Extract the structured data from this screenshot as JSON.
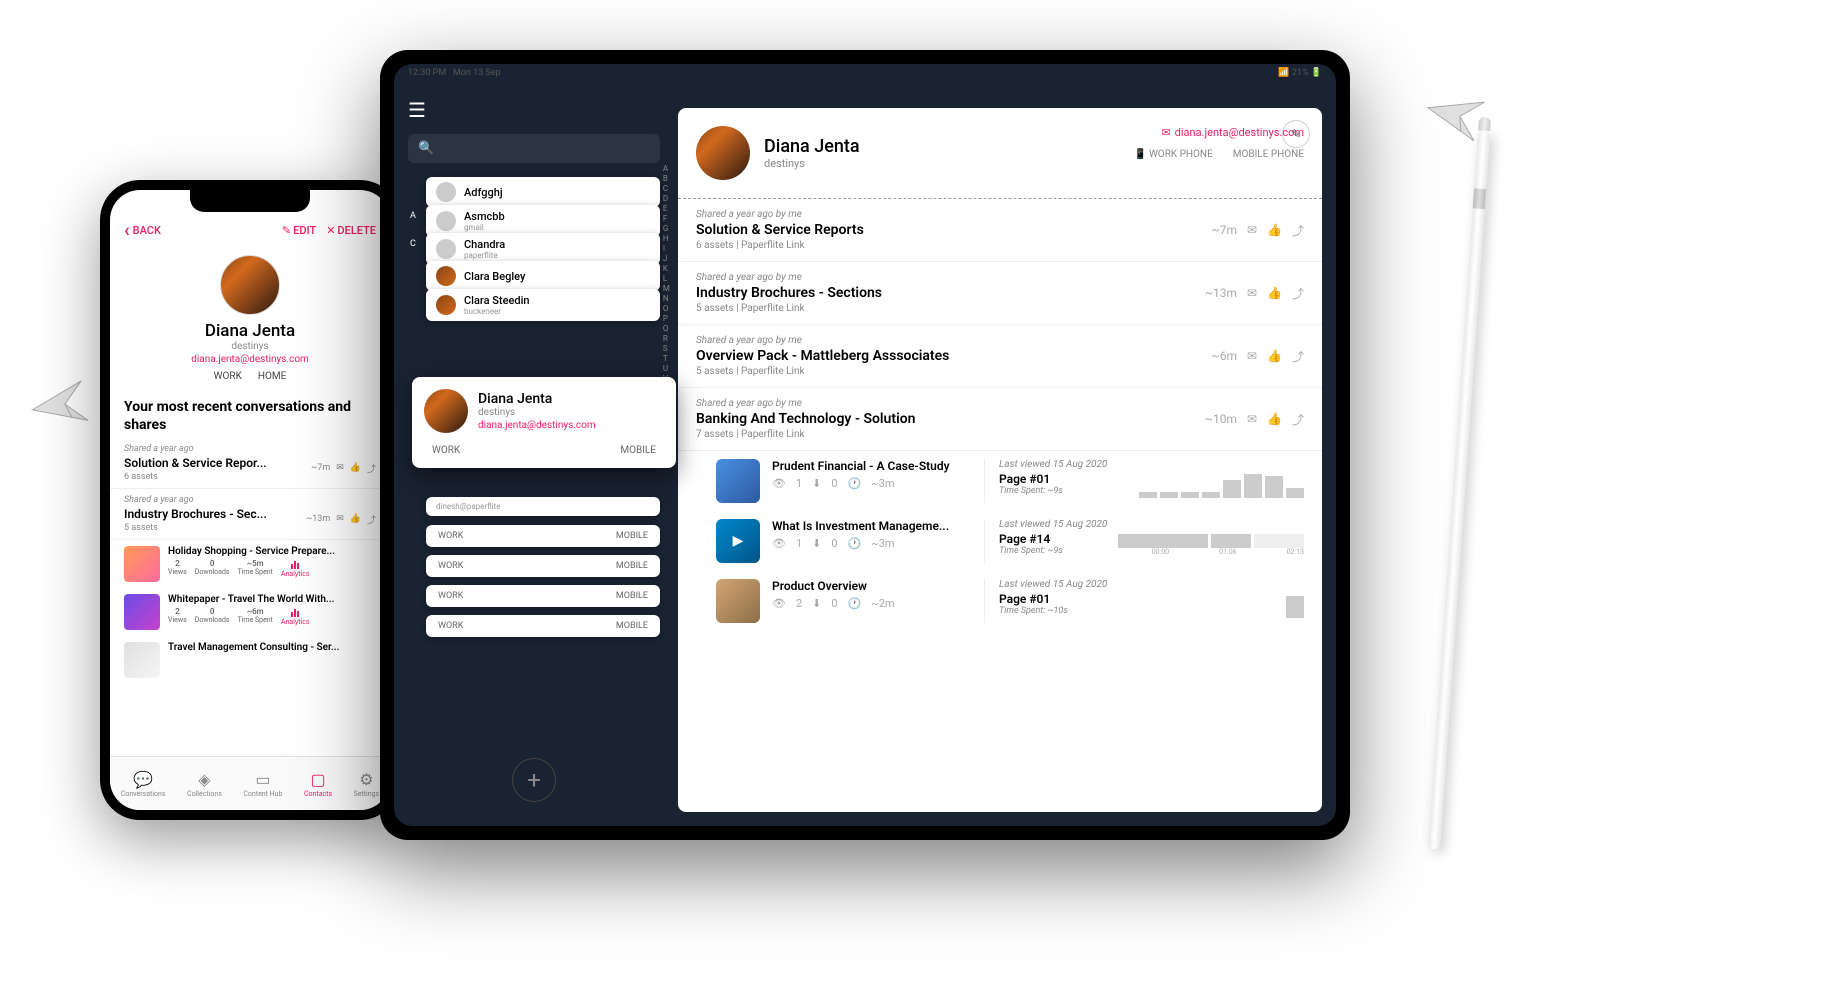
{
  "phone": {
    "back": "BACK",
    "edit": "EDIT",
    "delete": "DELETE",
    "profile": {
      "name": "Diana Jenta",
      "company": "destinys",
      "email": "diana.jenta@destinys.com",
      "tab_work": "WORK",
      "tab_home": "HOME"
    },
    "section_title": "Your most recent conversations and shares",
    "shares": [
      {
        "meta": "Shared a year ago",
        "title": "Solution & Service Repor...",
        "sub": "6 assets",
        "time": "~7m"
      },
      {
        "meta": "Shared a year ago",
        "title": "Industry Brochures - Sec...",
        "sub": "5 assets",
        "time": "~13m"
      }
    ],
    "assets": [
      {
        "title": "Holiday Shopping - Service Prepare...",
        "views": "2",
        "downloads": "0",
        "time": "~5m"
      },
      {
        "title": "Whitepaper - Travel The World With...",
        "views": "2",
        "downloads": "0",
        "time": "~6m"
      },
      {
        "title": "Travel Management Consulting - Ser...",
        "views": "",
        "downloads": "",
        "time": ""
      }
    ],
    "stat_labels": {
      "views": "Views",
      "downloads": "Downloads",
      "time": "Time Spent",
      "analytics": "Analytics"
    },
    "tabs": {
      "conversations": "Conversations",
      "collections": "Collections",
      "hub": "Content Hub",
      "contacts": "Contacts",
      "settings": "Settings"
    }
  },
  "tablet": {
    "status": {
      "time": "12:30 PM",
      "date": "Mon 13 Sep",
      "battery": "21%"
    },
    "search_placeholder": "",
    "contacts": [
      {
        "letter": "",
        "name": "Adfgghj",
        "sub": ""
      },
      {
        "letter": "A",
        "name": "Asmcbb",
        "sub": "gmail"
      },
      {
        "letter": "C",
        "name": "Chandra",
        "sub": "paperflite"
      },
      {
        "letter": "",
        "name": "Clara Begley",
        "sub": ""
      },
      {
        "letter": "",
        "name": "Clara Steedin",
        "sub": "buckeneer"
      }
    ],
    "selected": {
      "name": "Diana Jenta",
      "company": "destinys",
      "email": "diana.jenta@destinys.com",
      "work": "WORK",
      "mobile": "MOBILE"
    },
    "stack_below": {
      "name": "dinesh@paperflite",
      "work": "WORK",
      "mobile": "MOBILE"
    },
    "alpha": "ABCDEFGHIJKLMNOPQRSTUVWXYZ#",
    "detail": {
      "name": "Diana Jenta",
      "company": "destinys",
      "email": "diana.jenta@destinys.com",
      "work_phone": "WORK PHONE",
      "mobile_phone": "MOBILE PHONE"
    },
    "shares": [
      {
        "meta": "Shared a year ago by me",
        "title": "Solution & Service Reports",
        "sub": "6 assets | Paperflite Link",
        "time": "~7m"
      },
      {
        "meta": "Shared a year ago by me",
        "title": "Industry Brochures - Sections",
        "sub": "5 assets | Paperflite Link",
        "time": "~13m"
      },
      {
        "meta": "Shared a year ago by me",
        "title": "Overview Pack - Mattleberg Asssociates",
        "sub": "5 assets | Paperflite Link",
        "time": "~6m"
      },
      {
        "meta": "Shared a year ago by me",
        "title": "Banking And Technology - Solution",
        "sub": "7 assets | Paperflite Link",
        "time": "~10m"
      }
    ],
    "detail_assets": [
      {
        "title": "Prudent Financial - A Case-Study",
        "views": "1",
        "downloads": "0",
        "time": "~3m",
        "viewed": "Last viewed 15 Aug 2020",
        "page": "Page #01",
        "spent": "Time Spent: ~9s"
      },
      {
        "title": "What Is Investment Manageme...",
        "views": "1",
        "downloads": "0",
        "time": "~3m",
        "viewed": "Last viewed 15 Aug 2020",
        "page": "Page #14",
        "spent": "Time Spent: ~9s"
      },
      {
        "title": "Product Overview",
        "views": "2",
        "downloads": "0",
        "time": "~2m",
        "viewed": "Last viewed 15 Aug 2020",
        "page": "Page #01",
        "spent": "Time Spent: ~10s"
      }
    ],
    "timeline_labels": {
      "a": "00:00",
      "b": "01:06",
      "c": "02:13"
    }
  }
}
